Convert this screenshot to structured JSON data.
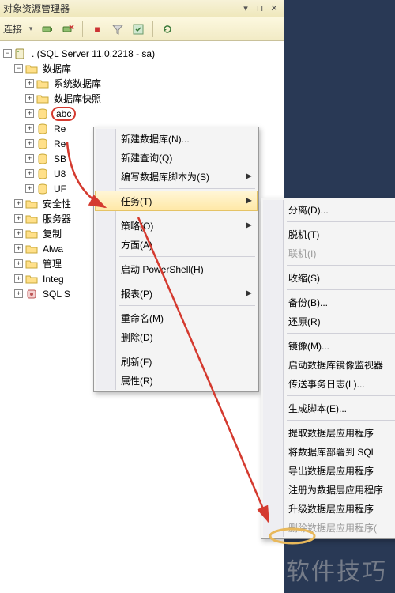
{
  "panel": {
    "title": "对象资源管理器",
    "win": {
      "pin": "▾",
      "unpin": "📌",
      "close": "✕"
    }
  },
  "toolbar": {
    "connect_label": "连接"
  },
  "tree": {
    "root": ". (SQL Server 11.0.2218 - sa)",
    "databases": "数据库",
    "sys_db": "系统数据库",
    "snapshots": "数据库快照",
    "db_abc": "abc",
    "db_re": "Re",
    "db_re2": "Re",
    "db_sb": "SB",
    "db_u8": "U8",
    "db_uf": "UF",
    "security": "安全性",
    "server_obj": "服务器",
    "replication": "复制",
    "alwayson": "Alwa",
    "management": "管理",
    "integration": "Integ",
    "sql_agent": "SQL S"
  },
  "menu1": {
    "items": [
      {
        "label": "新建数据库(N)...",
        "submenu": false
      },
      {
        "label": "新建查询(Q)",
        "submenu": false
      },
      {
        "label": "编写数据库脚本为(S)",
        "submenu": true
      },
      {
        "sep": true
      },
      {
        "label": "任务(T)",
        "submenu": true,
        "hover": true
      },
      {
        "sep": true
      },
      {
        "label": "策略(O)",
        "submenu": true
      },
      {
        "label": "方面(A)",
        "submenu": false
      },
      {
        "sep": true
      },
      {
        "label": "启动 PowerShell(H)",
        "submenu": false
      },
      {
        "sep": true
      },
      {
        "label": "报表(P)",
        "submenu": true
      },
      {
        "sep": true
      },
      {
        "label": "重命名(M)",
        "submenu": false
      },
      {
        "label": "删除(D)",
        "submenu": false
      },
      {
        "sep": true
      },
      {
        "label": "刷新(F)",
        "submenu": false
      },
      {
        "label": "属性(R)",
        "submenu": false
      }
    ]
  },
  "menu2": {
    "items": [
      {
        "label": "分离(D)...",
        "submenu": false
      },
      {
        "sep": true
      },
      {
        "label": "脱机(T)",
        "submenu": false
      },
      {
        "label": "联机(I)",
        "submenu": false,
        "disabled": true
      },
      {
        "sep": true
      },
      {
        "label": "收缩(S)",
        "submenu": true
      },
      {
        "sep": true
      },
      {
        "label": "备份(B)...",
        "submenu": false
      },
      {
        "label": "还原(R)",
        "submenu": true
      },
      {
        "sep": true
      },
      {
        "label": "镜像(M)...",
        "submenu": false
      },
      {
        "label": "启动数据库镜像监视器",
        "submenu": false
      },
      {
        "label": "传送事务日志(L)...",
        "submenu": false
      },
      {
        "sep": true
      },
      {
        "label": "生成脚本(E)...",
        "submenu": false
      },
      {
        "sep": true
      },
      {
        "label": "提取数据层应用程序",
        "submenu": false
      },
      {
        "label": "将数据库部署到 SQL",
        "submenu": false
      },
      {
        "label": "导出数据层应用程序",
        "submenu": false
      },
      {
        "label": "注册为数据层应用程序",
        "submenu": false
      },
      {
        "label": "升级数据层应用程序",
        "submenu": false
      },
      {
        "label": "删除数据层应用程序(",
        "submenu": false,
        "disabled": true
      }
    ]
  },
  "watermark": "软件技巧"
}
